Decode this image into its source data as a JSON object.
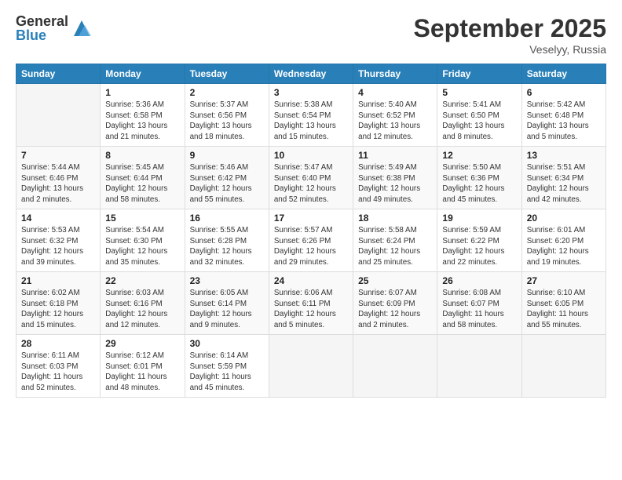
{
  "logo": {
    "general": "General",
    "blue": "Blue"
  },
  "title": "September 2025",
  "location": "Veselyy, Russia",
  "days_header": [
    "Sunday",
    "Monday",
    "Tuesday",
    "Wednesday",
    "Thursday",
    "Friday",
    "Saturday"
  ],
  "weeks": [
    [
      {
        "day": "",
        "info": ""
      },
      {
        "day": "1",
        "info": "Sunrise: 5:36 AM\nSunset: 6:58 PM\nDaylight: 13 hours\nand 21 minutes."
      },
      {
        "day": "2",
        "info": "Sunrise: 5:37 AM\nSunset: 6:56 PM\nDaylight: 13 hours\nand 18 minutes."
      },
      {
        "day": "3",
        "info": "Sunrise: 5:38 AM\nSunset: 6:54 PM\nDaylight: 13 hours\nand 15 minutes."
      },
      {
        "day": "4",
        "info": "Sunrise: 5:40 AM\nSunset: 6:52 PM\nDaylight: 13 hours\nand 12 minutes."
      },
      {
        "day": "5",
        "info": "Sunrise: 5:41 AM\nSunset: 6:50 PM\nDaylight: 13 hours\nand 8 minutes."
      },
      {
        "day": "6",
        "info": "Sunrise: 5:42 AM\nSunset: 6:48 PM\nDaylight: 13 hours\nand 5 minutes."
      }
    ],
    [
      {
        "day": "7",
        "info": "Sunrise: 5:44 AM\nSunset: 6:46 PM\nDaylight: 13 hours\nand 2 minutes."
      },
      {
        "day": "8",
        "info": "Sunrise: 5:45 AM\nSunset: 6:44 PM\nDaylight: 12 hours\nand 58 minutes."
      },
      {
        "day": "9",
        "info": "Sunrise: 5:46 AM\nSunset: 6:42 PM\nDaylight: 12 hours\nand 55 minutes."
      },
      {
        "day": "10",
        "info": "Sunrise: 5:47 AM\nSunset: 6:40 PM\nDaylight: 12 hours\nand 52 minutes."
      },
      {
        "day": "11",
        "info": "Sunrise: 5:49 AM\nSunset: 6:38 PM\nDaylight: 12 hours\nand 49 minutes."
      },
      {
        "day": "12",
        "info": "Sunrise: 5:50 AM\nSunset: 6:36 PM\nDaylight: 12 hours\nand 45 minutes."
      },
      {
        "day": "13",
        "info": "Sunrise: 5:51 AM\nSunset: 6:34 PM\nDaylight: 12 hours\nand 42 minutes."
      }
    ],
    [
      {
        "day": "14",
        "info": "Sunrise: 5:53 AM\nSunset: 6:32 PM\nDaylight: 12 hours\nand 39 minutes."
      },
      {
        "day": "15",
        "info": "Sunrise: 5:54 AM\nSunset: 6:30 PM\nDaylight: 12 hours\nand 35 minutes."
      },
      {
        "day": "16",
        "info": "Sunrise: 5:55 AM\nSunset: 6:28 PM\nDaylight: 12 hours\nand 32 minutes."
      },
      {
        "day": "17",
        "info": "Sunrise: 5:57 AM\nSunset: 6:26 PM\nDaylight: 12 hours\nand 29 minutes."
      },
      {
        "day": "18",
        "info": "Sunrise: 5:58 AM\nSunset: 6:24 PM\nDaylight: 12 hours\nand 25 minutes."
      },
      {
        "day": "19",
        "info": "Sunrise: 5:59 AM\nSunset: 6:22 PM\nDaylight: 12 hours\nand 22 minutes."
      },
      {
        "day": "20",
        "info": "Sunrise: 6:01 AM\nSunset: 6:20 PM\nDaylight: 12 hours\nand 19 minutes."
      }
    ],
    [
      {
        "day": "21",
        "info": "Sunrise: 6:02 AM\nSunset: 6:18 PM\nDaylight: 12 hours\nand 15 minutes."
      },
      {
        "day": "22",
        "info": "Sunrise: 6:03 AM\nSunset: 6:16 PM\nDaylight: 12 hours\nand 12 minutes."
      },
      {
        "day": "23",
        "info": "Sunrise: 6:05 AM\nSunset: 6:14 PM\nDaylight: 12 hours\nand 9 minutes."
      },
      {
        "day": "24",
        "info": "Sunrise: 6:06 AM\nSunset: 6:11 PM\nDaylight: 12 hours\nand 5 minutes."
      },
      {
        "day": "25",
        "info": "Sunrise: 6:07 AM\nSunset: 6:09 PM\nDaylight: 12 hours\nand 2 minutes."
      },
      {
        "day": "26",
        "info": "Sunrise: 6:08 AM\nSunset: 6:07 PM\nDaylight: 11 hours\nand 58 minutes."
      },
      {
        "day": "27",
        "info": "Sunrise: 6:10 AM\nSunset: 6:05 PM\nDaylight: 11 hours\nand 55 minutes."
      }
    ],
    [
      {
        "day": "28",
        "info": "Sunrise: 6:11 AM\nSunset: 6:03 PM\nDaylight: 11 hours\nand 52 minutes."
      },
      {
        "day": "29",
        "info": "Sunrise: 6:12 AM\nSunset: 6:01 PM\nDaylight: 11 hours\nand 48 minutes."
      },
      {
        "day": "30",
        "info": "Sunrise: 6:14 AM\nSunset: 5:59 PM\nDaylight: 11 hours\nand 45 minutes."
      },
      {
        "day": "",
        "info": ""
      },
      {
        "day": "",
        "info": ""
      },
      {
        "day": "",
        "info": ""
      },
      {
        "day": "",
        "info": ""
      }
    ]
  ]
}
